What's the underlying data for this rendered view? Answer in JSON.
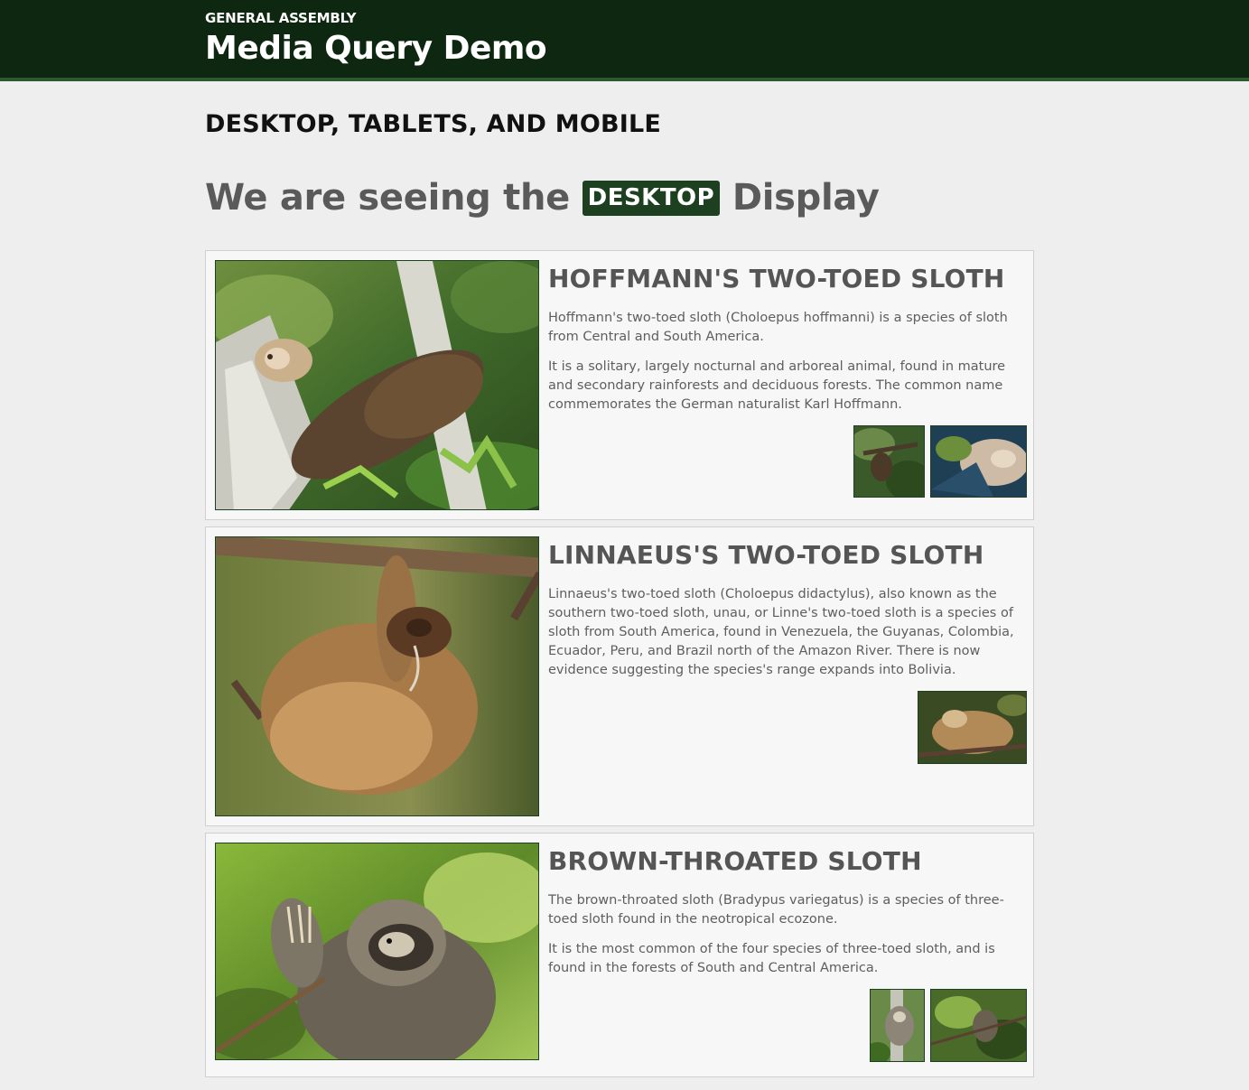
{
  "header": {
    "brand": "GENERAL ASSEMBLY",
    "title": "Media Query Demo"
  },
  "subtitle": "DESKTOP, TABLETS, AND MOBILE",
  "display": {
    "prefix": "We are seeing the",
    "badge": "DESKTOP",
    "suffix": "Display"
  },
  "sloths": [
    {
      "title": "HOFFMANN'S TWO-TOED SLOTH",
      "paragraphs": [
        "Hoffmann's two-toed sloth (Choloepus hoffmanni) is a species of sloth from Central and South America.",
        "It is a solitary, largely nocturnal and arboreal animal, found in mature and secondary rainforests and deciduous forests. The common name commemorates the German naturalist Karl Hoffmann."
      ],
      "thumbnails": 2
    },
    {
      "title": "LINNAEUS'S TWO-TOED SLOTH",
      "paragraphs": [
        "Linnaeus's two-toed sloth (Choloepus didactylus), also known as the southern two-toed sloth, unau, or Linne's two-toed sloth is a species of sloth from South America, found in Venezuela, the Guyanas, Colombia, Ecuador, Peru, and Brazil north of the Amazon River. There is now evidence suggesting the species's range expands into Bolivia."
      ],
      "thumbnails": 1
    },
    {
      "title": "BROWN-THROATED SLOTH",
      "paragraphs": [
        "The brown-throated sloth (Bradypus variegatus) is a species of three-toed sloth found in the neotropical ecozone.",
        "It is the most common of the four species of three-toed sloth, and is found in the forests of South and Central America."
      ],
      "thumbnails": 2
    }
  ],
  "colors": {
    "header_bg": "#0d2710",
    "accent": "#1c4020",
    "page_bg": "#eeeeee"
  }
}
